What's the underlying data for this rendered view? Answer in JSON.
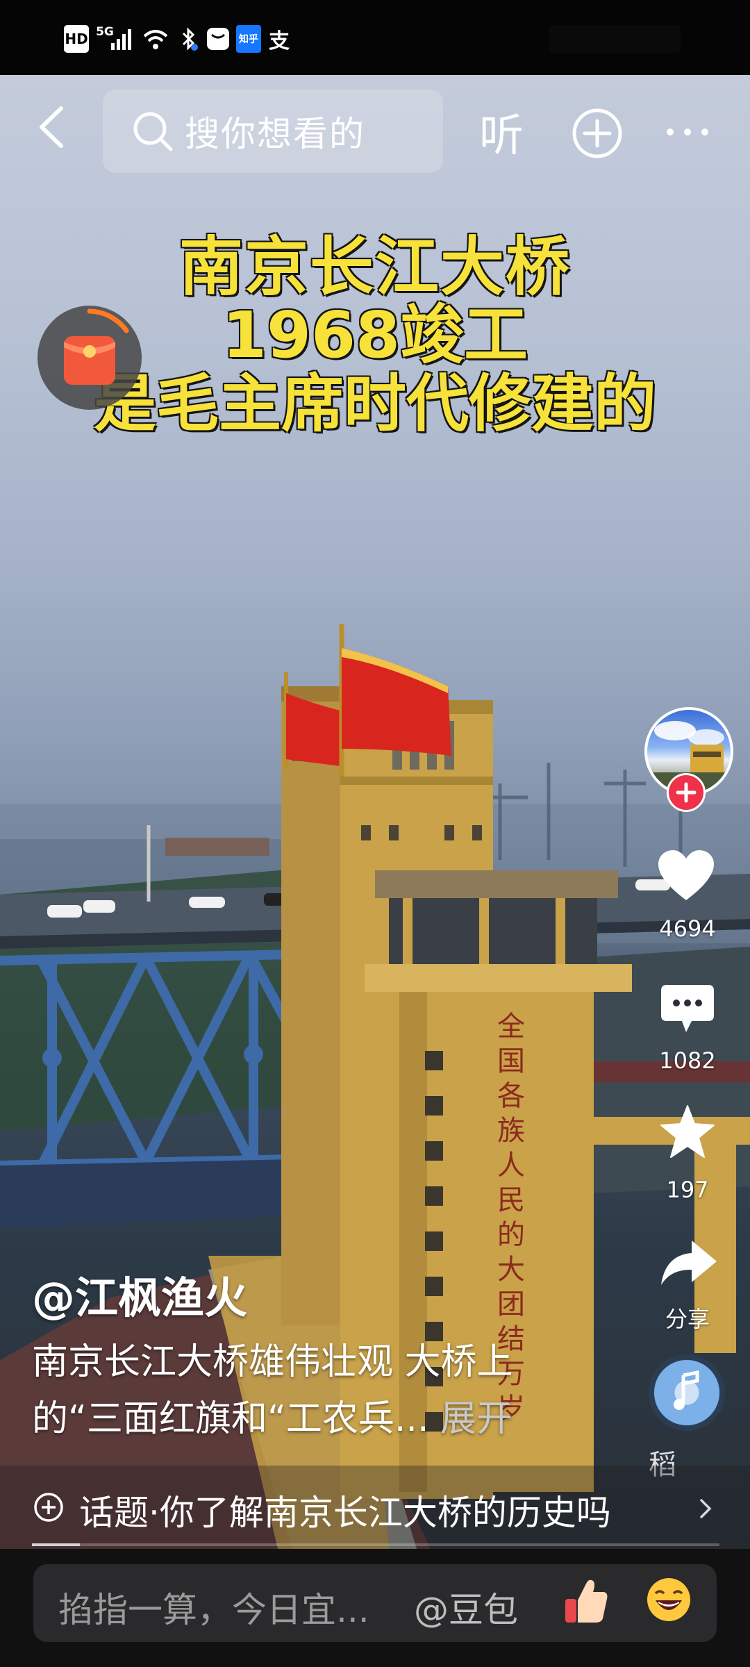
{
  "status_bar": {
    "left_icons": [
      "HD",
      "5G",
      "signal-icon",
      "wifi-icon",
      "bluetooth-icon",
      "message-icon",
      "知乎",
      "支"
    ]
  },
  "nav": {
    "search_placeholder": "搜你想看的",
    "listen_label": "听",
    "icons": [
      "back-icon",
      "search-icon",
      "add-icon",
      "more-icon"
    ]
  },
  "video": {
    "title_lines": [
      "南京长江大桥",
      "1968竣工",
      "是毛主席时代修建的"
    ],
    "tower_inscription": "全国各族人民的大团结万岁"
  },
  "rail": {
    "likes": "4694",
    "comments": "1082",
    "favorites": "197",
    "share_label": "分享",
    "watermark": "稻"
  },
  "caption": {
    "author": "@江枫渔火",
    "desc_line1": "南京长江大桥雄伟壮观 大桥上",
    "desc_line2": "的“三面红旗和“工农兵...",
    "expand_label": "展开",
    "topic": "话题·你了解南京长江大桥的历史吗",
    "progress": 0.07
  },
  "bottom_bar": {
    "comment_placeholder": "掐指一算，今日宜...",
    "mention": "@豆包"
  },
  "colors": {
    "title_yellow": "#f6e23a",
    "follow_red": "#f0314a",
    "flag_red": "#d8261e",
    "tower_yellow": "#c9a24a"
  }
}
